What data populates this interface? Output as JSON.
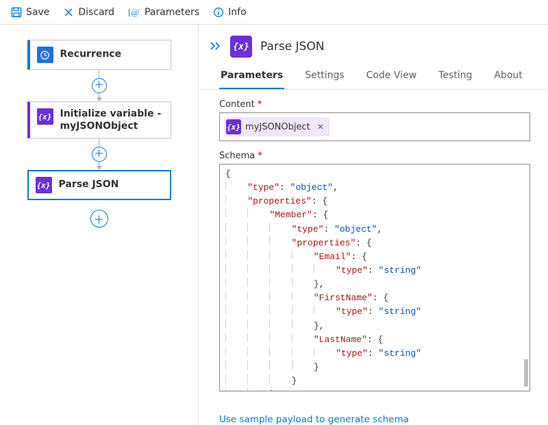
{
  "toolbar": {
    "save": "Save",
    "discard": "Discard",
    "parameters": "Parameters",
    "info": "Info"
  },
  "canvas": {
    "nodes": {
      "recurrence": "Recurrence",
      "initVar": "Initialize variable - myJSONObject",
      "parseJson": "Parse JSON"
    }
  },
  "panel": {
    "title": "Parse JSON",
    "tabs": {
      "parameters": "Parameters",
      "settings": "Settings",
      "codeView": "Code View",
      "testing": "Testing",
      "about": "About"
    },
    "fields": {
      "contentLabel": "Content",
      "contentToken": "myJSONObject",
      "schemaLabel": "Schema",
      "schemaLink": "Use sample payload to generate schema"
    },
    "schemaJson": {
      "type": "object",
      "properties": {
        "Member": {
          "type": "object",
          "properties": {
            "Email": {
              "type": "string"
            },
            "FirstName": {
              "type": "string"
            },
            "LastName": {
              "type": "string"
            }
          }
        }
      }
    }
  }
}
